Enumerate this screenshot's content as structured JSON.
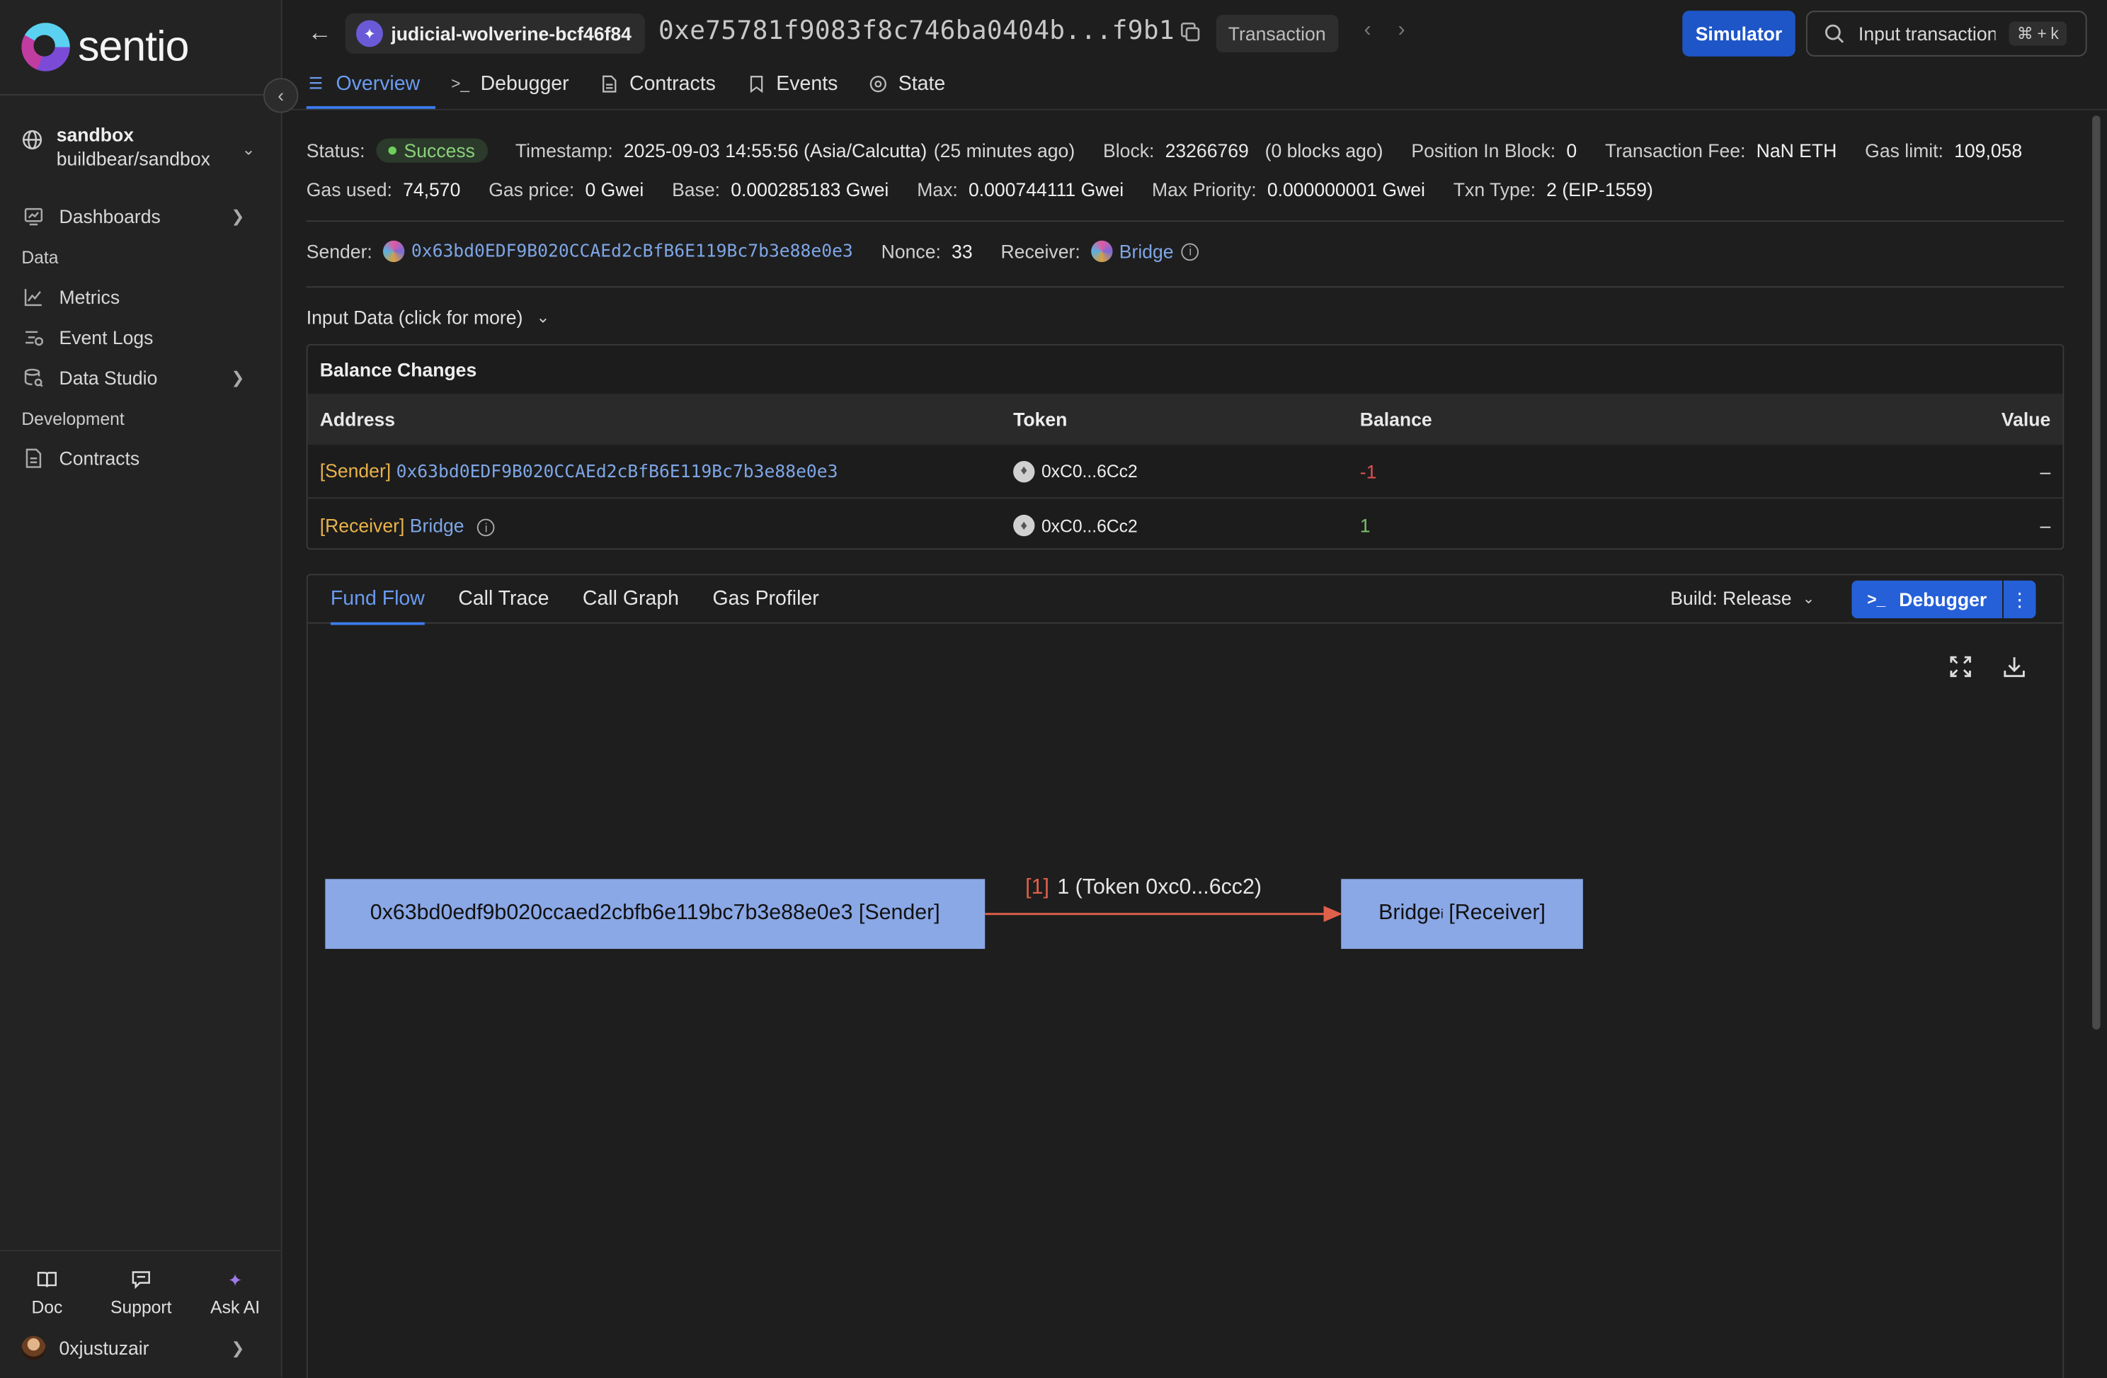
{
  "app": {
    "logo_text": "sentio",
    "project": {
      "name": "sandbox",
      "path": "buildbear/sandbox"
    }
  },
  "sidebar": {
    "items_top": [
      {
        "label": "Dashboards",
        "icon": "dashboard-icon"
      }
    ],
    "section_data": "Data",
    "data_items": [
      {
        "label": "Metrics",
        "icon": "metrics-icon"
      },
      {
        "label": "Event Logs",
        "icon": "event-logs-icon"
      },
      {
        "label": "Data Studio",
        "icon": "data-studio-icon"
      }
    ],
    "section_dev": "Development",
    "dev_items": [
      {
        "label": "Contracts",
        "icon": "contracts-icon"
      }
    ],
    "bottom": [
      {
        "label": "Doc",
        "icon": "book-icon"
      },
      {
        "label": "Support",
        "icon": "chat-icon"
      },
      {
        "label": "Ask AI",
        "icon": "sparkle-icon"
      }
    ],
    "user": "0xjustuzair"
  },
  "header": {
    "project_chip": "judicial-wolverine-bcf46f84",
    "tx_hash": "0xe75781f9083f8c746ba0404b...f9b1",
    "type_chip": "Transaction",
    "simulator_label": "Simulator",
    "search_placeholder": "Input transaction",
    "kbd_cmd": "⌘",
    "kbd_plus": "+",
    "kbd_k": "k",
    "tabs": [
      "Overview",
      "Debugger",
      "Contracts",
      "Events",
      "State"
    ]
  },
  "overview": {
    "status_label": "Status:",
    "status": "Success",
    "timestamp_label": "Timestamp:",
    "timestamp": "2025-09-03 14:55:56 (Asia/Calcutta)",
    "timestamp_rel": "(25 minutes ago)",
    "block_label": "Block:",
    "block": "23266769",
    "block_rel": "(0 blocks ago)",
    "position_label": "Position In Block:",
    "position": "0",
    "fee_label": "Transaction Fee:",
    "fee": "NaN ETH",
    "gas_limit_label": "Gas limit:",
    "gas_limit": "109,058",
    "gas_used_label": "Gas used:",
    "gas_used": "74,570",
    "gas_price_label": "Gas price:",
    "gas_price": "0 Gwei",
    "base_label": "Base:",
    "base": "0.000285183 Gwei",
    "max_label": "Max:",
    "max": "0.000744111 Gwei",
    "max_priority_label": "Max Priority:",
    "max_priority": "0.000000001 Gwei",
    "txn_type_label": "Txn Type:",
    "txn_type": "2 (EIP-1559)",
    "sender_label": "Sender:",
    "sender": "0x63bd0EDF9B020CCAEd2cBfB6E119Bc7b3e88e0e3",
    "nonce_label": "Nonce:",
    "nonce": "33",
    "receiver_label": "Receiver:",
    "receiver": "Bridge",
    "input_data": "Input Data (click for more)"
  },
  "balance_changes": {
    "title": "Balance Changes",
    "columns": [
      "Address",
      "Token",
      "Balance",
      "Value"
    ],
    "rows": [
      {
        "tag": "[Sender]",
        "address": "0x63bd0EDF9B020CCAEd2cBfB6E119Bc7b3e88e0e3",
        "token": "0xC0...6Cc2",
        "balance": "-1",
        "value": "–"
      },
      {
        "tag": "[Receiver]",
        "address": "Bridge",
        "token": "0xC0...6Cc2",
        "balance": "1",
        "value": "–"
      }
    ]
  },
  "flow": {
    "tabs": [
      "Fund Flow",
      "Call Trace",
      "Call Graph",
      "Gas Profiler"
    ],
    "build": "Build: Release",
    "debugger_label": "Debugger",
    "sender_node": "0x63bd0edf9b020ccaed2cbfb6e119bc7b3e88e0e3 [Sender]",
    "receiver_node": "Bridge",
    "receiver_node_sup": "i",
    "receiver_node_tag": "[Receiver]",
    "edge_index": "[1]",
    "edge_label": "1 (Token 0xc0...6cc2)",
    "edge_color": "#e0604a",
    "node_color": "#8aa7e6"
  }
}
